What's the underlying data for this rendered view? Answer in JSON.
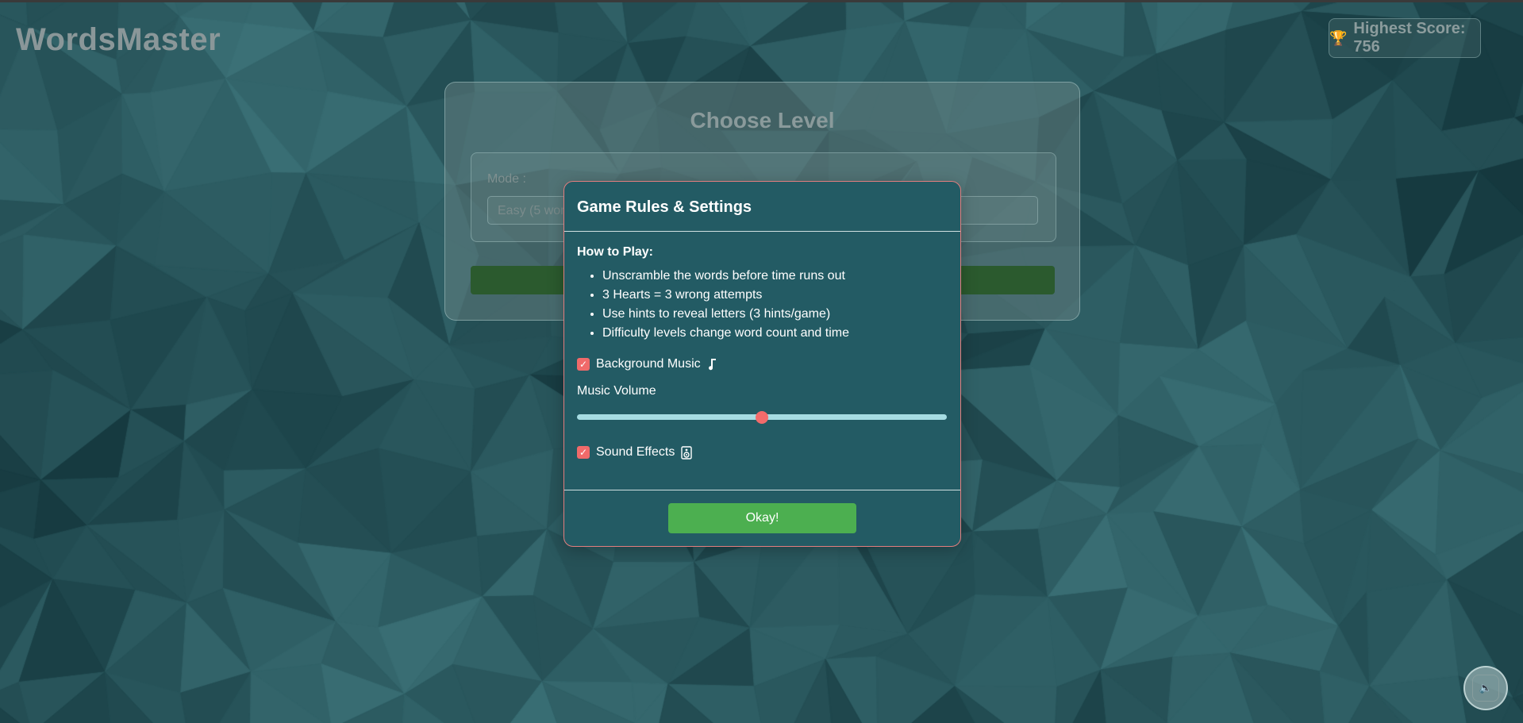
{
  "app": {
    "brand": "WordsMaster",
    "highest_score_label": "Highest Score: 756",
    "trophy_icon": "trophy-icon"
  },
  "level_card": {
    "title": "Choose Level",
    "mode_label": "Mode :",
    "mode_selected": "Easy (5 words"
  },
  "modal": {
    "title": "Game Rules & Settings",
    "how_to_play_heading": "How to Play:",
    "rules": [
      "Unscramble the words before time runs out",
      "3 Hearts = 3 wrong attempts",
      "Use hints to reveal letters (3 hints/game)",
      "Difficulty levels change word count and time"
    ],
    "background_music_label": "Background Music",
    "background_music_checked": true,
    "music_icon": "music-note-icon",
    "music_volume_label": "Music Volume",
    "music_volume_fraction": 0.5,
    "sound_effects_label": "Sound Effects",
    "sound_effects_checked": true,
    "speaker_icon": "speaker-icon",
    "okay_button_label": "Okay!"
  },
  "colors": {
    "modal_bg": "#235b64",
    "modal_border": "#e37e7e",
    "accent_red": "#f06a6a",
    "okay_green": "#4caf50",
    "slider_track": "#a6dce2"
  }
}
